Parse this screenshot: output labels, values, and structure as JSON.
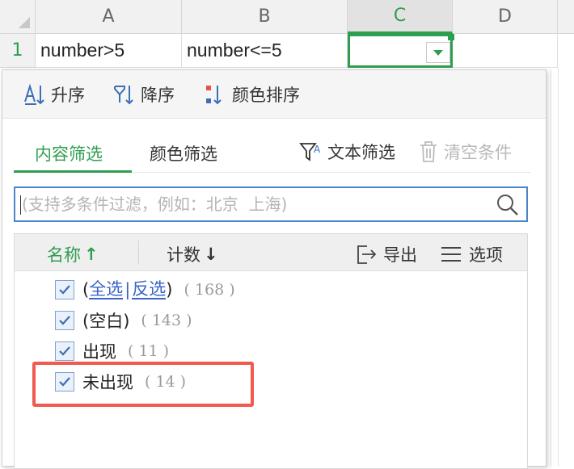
{
  "sheet": {
    "columns": [
      "A",
      "B",
      "C",
      "D"
    ],
    "row_number": "1",
    "cells": {
      "A1": "number>5",
      "B1": "number<=5",
      "C1": ""
    }
  },
  "filter": {
    "sort": {
      "ascending": "升序",
      "descending": "降序",
      "by_color": "颜色排序"
    },
    "tabs": {
      "content": "内容筛选",
      "color": "颜色筛选"
    },
    "text_filter": "文本筛选",
    "clear_conditions": "清空条件",
    "search": {
      "placeholder": "(支持多条件过滤，例如：北京  上海)"
    },
    "list_header": {
      "name": "名称",
      "name_arrow": "↑",
      "count": "计数",
      "count_arrow": "↓",
      "export": "导出",
      "options": "选项"
    },
    "select_all": "全选",
    "divider": "|",
    "invert": "反选",
    "items": [
      {
        "open": "(",
        "close": ")",
        "count": "(  168  )"
      },
      {
        "label": "(空白)",
        "count": "(  143  )"
      },
      {
        "label": "出现",
        "count": "(  11  )"
      },
      {
        "label": "未出现",
        "count": "(  14  )"
      }
    ]
  },
  "colors": {
    "accent": "#2f9e4f",
    "link": "#3a64c7",
    "highlight": "#f05a4f",
    "search_border": "#4a86c8"
  }
}
